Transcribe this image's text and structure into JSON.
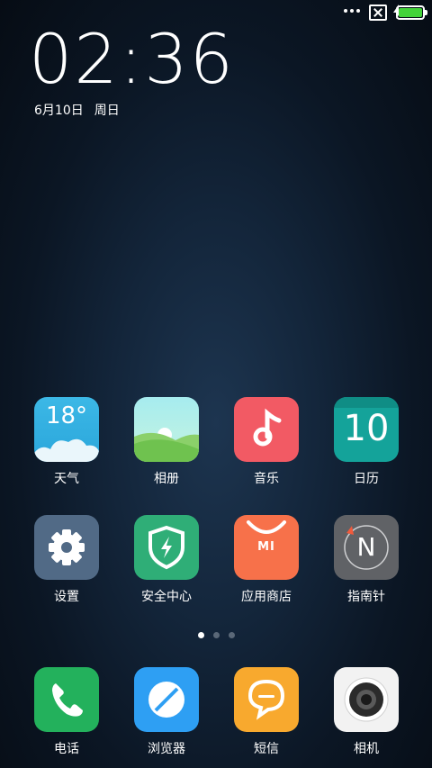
{
  "status": {
    "battery_color": "#43d339"
  },
  "lockclock": {
    "time": "02:36",
    "date": "6月10日",
    "weekday": "周日"
  },
  "apps": [
    {
      "label": "天气",
      "temp": "18°",
      "icon": "weather-icon",
      "color": "#39b4e0"
    },
    {
      "label": "相册",
      "icon": "gallery-icon",
      "color": "#8fd36a"
    },
    {
      "label": "音乐",
      "icon": "music-icon",
      "color": "#f25a64"
    },
    {
      "label": "日历",
      "day": "10",
      "icon": "calendar-icon",
      "color": "#14a39a"
    },
    {
      "label": "设置",
      "icon": "gear-icon",
      "color": "#516a86"
    },
    {
      "label": "安全中心",
      "icon": "shield-icon",
      "color": "#2fae77"
    },
    {
      "label": "应用商店",
      "brand": "MI",
      "icon": "store-bag-icon",
      "color": "#f7714a"
    },
    {
      "label": "指南针",
      "letter": "N",
      "icon": "compass-icon",
      "color": "#606266"
    },
    {
      "label": "电话",
      "icon": "phone-icon",
      "color": "#23b15c"
    },
    {
      "label": "浏览器",
      "icon": "browser-icon",
      "color": "#2e9ff3"
    },
    {
      "label": "短信",
      "icon": "message-icon",
      "color": "#f8a92e"
    },
    {
      "label": "相机",
      "icon": "camera-icon",
      "color": "#f2f2f2"
    }
  ],
  "pager": {
    "pages": 3,
    "current": 1
  }
}
